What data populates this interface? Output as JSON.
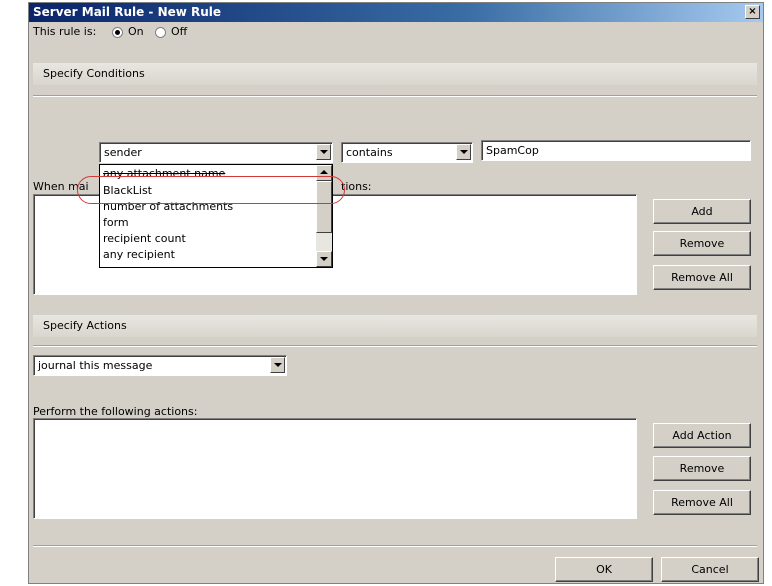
{
  "window": {
    "title": "Server Mail Rule - New Rule",
    "close_glyph": "×"
  },
  "rule_state": {
    "label": "This rule is:",
    "on_label": "On",
    "off_label": "Off",
    "selected": "On"
  },
  "conditions": {
    "section_label": "Specify Conditions",
    "field_select": "sender",
    "operator_select": "contains",
    "value_input": "SpamCop",
    "dropdown_options": [
      "any attachment name",
      "BlackList",
      "number of attachments",
      "form",
      "recipient count",
      "any recipient"
    ],
    "highlighted_option": "BlackList",
    "list_label_left": "When mai",
    "list_label_right": "tions:",
    "add_label": "Add",
    "remove_label": "Remove",
    "remove_all_label": "Remove All"
  },
  "actions": {
    "section_label": "Specify Actions",
    "action_select": "journal this message",
    "list_label": "Perform the following actions:",
    "add_action_label": "Add Action",
    "remove_label": "Remove",
    "remove_all_label": "Remove All"
  },
  "footer": {
    "ok_label": "OK",
    "cancel_label": "Cancel"
  },
  "colors": {
    "titlebar_start": "#0a246a",
    "dialog_bg": "#d4d0c8",
    "callout": "#d23a3a"
  }
}
